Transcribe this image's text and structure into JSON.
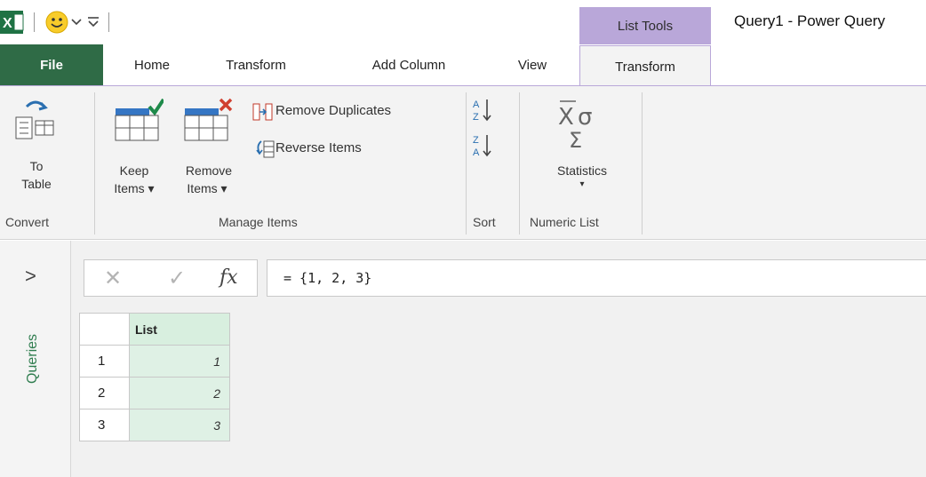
{
  "title_bar": {
    "app_icon": "excel-icon",
    "quick_access_icons": [
      "smiley-icon",
      "dropdown-arrow-icon",
      "customize-icon"
    ],
    "contextual_group": "List Tools",
    "window_title": "Query1 - Power Query"
  },
  "tabs": {
    "file": "File",
    "home": "Home",
    "transform": "Transform",
    "add_column": "Add Column",
    "view": "View",
    "list_transform": "Transform"
  },
  "ribbon": {
    "convert": {
      "to_table_line1": "To",
      "to_table_line2": "Table",
      "group_label": "Convert"
    },
    "manage_items": {
      "keep_line1": "Keep",
      "keep_line2": "Items ▾",
      "remove_line1": "Remove",
      "remove_line2": "Items ▾",
      "remove_duplicates": "Remove Duplicates",
      "reverse_items": "Reverse Items",
      "group_label": "Manage Items"
    },
    "sort": {
      "group_label": "Sort"
    },
    "numeric_list": {
      "statistics": "Statistics",
      "statistics_arrow": "▾",
      "group_label": "Numeric List"
    }
  },
  "queries_pane": {
    "label": "Queries",
    "expand_glyph": ">"
  },
  "formula_bar": {
    "cancel_glyph": "✕",
    "commit_glyph": "✓",
    "fx_glyph": "fx",
    "formula": "= {1, 2, 3}"
  },
  "grid": {
    "column_header": "List",
    "rows": [
      {
        "num": "1",
        "value": "1"
      },
      {
        "num": "2",
        "value": "2"
      },
      {
        "num": "3",
        "value": "3"
      }
    ]
  },
  "colors": {
    "file_tab": "#2f6b46",
    "contextual_tab": "#b9a7d9",
    "queries_label": "#2f7d4f",
    "selected_column": "#dff1e5"
  }
}
